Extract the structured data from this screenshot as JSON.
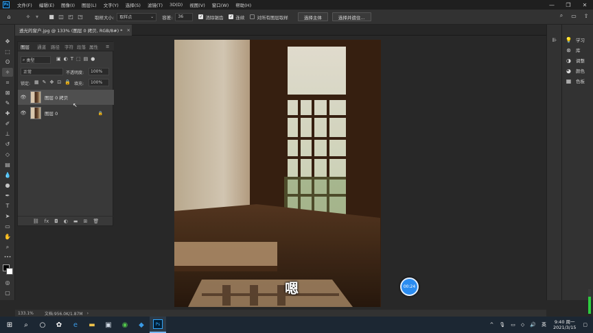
{
  "menubar": {
    "logo": "Ps",
    "items": [
      "文件(F)",
      "编辑(E)",
      "图像(I)",
      "图层(L)",
      "文字(Y)",
      "选择(S)",
      "滤镜(T)",
      "3D(D)",
      "视图(V)",
      "窗口(W)",
      "帮助(H)"
    ]
  },
  "options": {
    "sample_size_label": "取样大小:",
    "sample_size_value": "取样点",
    "tolerance_label": "容差:",
    "tolerance_value": "36",
    "antialias_label": "消除锯齿",
    "contiguous_label": "连续",
    "all_layers_label": "对所有图层取样",
    "select_subject": "选择主体",
    "select_mask": "选择并遮住..."
  },
  "document": {
    "tab_title": "透光的窗户.jpg @ 133% (图层 0 拷贝, RGB/8#) *"
  },
  "layers_panel": {
    "tabs": [
      "图层",
      "通道",
      "路径",
      "字符",
      "段落",
      "属性"
    ],
    "filter_label": "类型",
    "blend_mode": "正常",
    "opacity_label": "不透明度:",
    "opacity_value": "100%",
    "lock_label": "锁定:",
    "fill_label": "填充:",
    "fill_value": "100%",
    "layers": [
      {
        "name": "图层 0 拷贝",
        "locked": false,
        "selected": true
      },
      {
        "name": "图层 0",
        "locked": true,
        "selected": false
      }
    ]
  },
  "right_panel": {
    "items": [
      {
        "label": "学习",
        "icon": "lightbulb-icon"
      },
      {
        "label": "库",
        "icon": "library-icon"
      },
      {
        "label": "调整",
        "icon": "adjustments-icon"
      },
      {
        "label": "颜色",
        "icon": "color-icon"
      },
      {
        "label": "色板",
        "icon": "swatches-icon"
      }
    ]
  },
  "status": {
    "zoom": "133.1%",
    "doc_size": "文档:956.0K/1.87M"
  },
  "overlay": {
    "subtitle": "嗯",
    "timer": "00:24"
  },
  "taskbar": {
    "lang": "英",
    "time": "9:40 周一",
    "date": "2021/3/15"
  }
}
